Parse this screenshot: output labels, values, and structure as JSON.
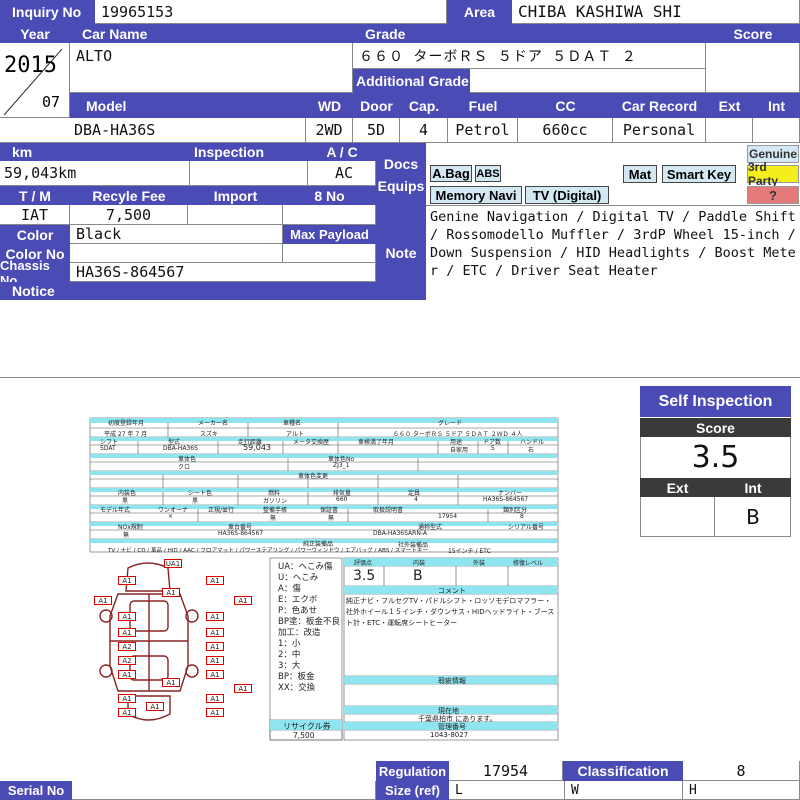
{
  "labels": {
    "inquiry_no": "Inquiry No",
    "area": "Area",
    "year": "Year",
    "car_name": "Car Name",
    "grade": "Grade",
    "score": "Score",
    "additional_grade": "Additional Grade",
    "model": "Model",
    "wd": "WD",
    "door": "Door",
    "cap": "Cap.",
    "fuel": "Fuel",
    "cc": "CC",
    "car_record": "Car Record",
    "ext": "Ext",
    "int": "Int",
    "km": "km",
    "inspection": "Inspection",
    "ac": "A / C",
    "docs_equips": [
      "Docs",
      "Equips"
    ],
    "tm": "T / M",
    "recycle_fee": "Recyle Fee",
    "import": "Import",
    "eight_no": "8 No",
    "color": "Color",
    "max_payload": "Max Payload",
    "color_no": "Color No",
    "note": "Note",
    "chassis_no": "Chassis No",
    "notice": "Notice",
    "regulation": "Regulation",
    "classification": "Classification",
    "serial_no": "Serial No",
    "size_ref": "Size (ref)"
  },
  "values": {
    "inquiry_no": "19965153",
    "area": "CHIBA KASHIWA SHI",
    "year": "2015",
    "month": "07",
    "car_name": "ALTO",
    "grade": "６６０ ターボＲＳ ５ドア ５ＤＡＴ ２",
    "model": "DBA-HA36S",
    "wd": "2WD",
    "door": "5D",
    "cap": "4",
    "fuel": "Petrol",
    "cc": "660cc",
    "car_record": "Personal",
    "km": "59,043km",
    "ac": "AC",
    "tm": "IAT",
    "recycle_fee": "7,500",
    "color": "Black",
    "chassis_no": "HA36S-864567",
    "note": "Genine Navigation / Digital TV / Paddle Shift / Rossomodello Muffler / 3rdP Wheel 15-inch / Down Suspension / HID Headlights / Boost Meter / ETC / Driver Seat Heater",
    "regulation": "17954",
    "classification": "8",
    "size_l": "L",
    "size_w": "W",
    "size_h": "H"
  },
  "equips": {
    "abag": "A.Bag",
    "abs": "ABS",
    "mat": "Mat",
    "smart_key": "Smart Key",
    "memory_navi": "Memory Navi",
    "tv_digital": "TV (Digital)",
    "genuine": "Genuine",
    "third_party": "3rd Party",
    "question": "?"
  },
  "self_inspection": {
    "title": "Self Inspection",
    "score_label": "Score",
    "score": "3.5",
    "ext_label": "Ext",
    "int_label": "Int",
    "ext": "",
    "int": "B"
  },
  "sheet": {
    "row1_labels": [
      "初度登録年月",
      "メーカー名",
      "車種名",
      "グレード"
    ],
    "row1_values": [
      "平成 27 年 7 月",
      "スズキ",
      "アルト",
      "６６０ ターボＲＳ ５ドア ５ＤＡＴ ２ＷＤ ４人"
    ],
    "row2_labels": [
      "シフト",
      "型式",
      "走行距離",
      "メータ交換歴",
      "車検満了年月",
      "用途",
      "ドア数",
      "ハンドル"
    ],
    "row2_values": [
      "5DAT",
      "DBA-HA36S",
      "59,043",
      "",
      "",
      "自家用",
      "5",
      "右"
    ],
    "color_label": "車体色",
    "color_value": "クロ",
    "color_code_label": "車体色No",
    "color_code_value": "ZJ3_1",
    "interior_label": "車体色変更",
    "row3_labels": [
      "内装色",
      "シート色",
      "燃料",
      "排気量",
      "定員",
      "ナンバー"
    ],
    "row3_values": [
      "黒",
      "黒",
      "ガソリン",
      "660",
      "4",
      "HA36S-864567"
    ],
    "row4_labels": [
      "モデル年式",
      "ワンオーナ",
      "正規/並行",
      "整備手帳",
      "保証書",
      "取扱説明書",
      "類別区分"
    ],
    "row4_values": [
      "",
      "×",
      "",
      "無",
      "無",
      "17954",
      "8"
    ],
    "nox_label": "NOx規制",
    "frame_label": "車台番号",
    "engine_label": "通称型式",
    "serial_label": "シリアル番号",
    "nox_value": "無",
    "frame_value": "HA36S-864567",
    "engine_value": "DBA-HA36SARN-A",
    "equip_label": "純正装備品",
    "equip_value": "TV / ナビ / CD / 革品 / HID / AAC / フロアマット / パワーステアリング / パワーウィンドウ / エアバッグ / ABS / スマートキー",
    "aftermarket_label": "社外装備品",
    "aftermarket_value": "15インチ / ETC",
    "legend": [
      "UA：へこみ傷",
      "U：へこみ",
      "A：傷",
      "E：エクボ",
      "P：色あせ",
      "BP塗：板金不良",
      "加工：改造",
      "1：小",
      "2：中",
      "3：大",
      "BP：板金",
      "XX：交換"
    ],
    "recycle_label": "リサイクル券",
    "recycle_value": "7,500",
    "grade_headers": [
      "評価点",
      "内装",
      "外装",
      "修復レベル"
    ],
    "grade_values": [
      "3.5",
      "B",
      "",
      ""
    ],
    "comment_label": "コメント",
    "comment": "純正ナビ・フルセグTV・パドルシフト・ロッソモデロマフラー・社外ホイール１５インチ・ダウンサス・HIDヘッドライト・ブースト計・ETC・運転席シートヒーター",
    "history_label": "瑕疵情報",
    "location_label": "現在地",
    "location_value": "千葉県柏市 にあります。",
    "manage_label": "管理番号",
    "manage_value": "1043-8027",
    "marks": [
      "UA1",
      "A1",
      "A1",
      "A1",
      "A1",
      "A1",
      "A1",
      "A1",
      "A1",
      "A1",
      "A2",
      "A1",
      "A2",
      "A1",
      "A1",
      "A1",
      "A1",
      "A1",
      "A1",
      "A1",
      "A1",
      "A1",
      "A1"
    ]
  },
  "colors": {
    "header_bg": "#4a4bb5",
    "badge_bg": "#d4e8f4",
    "third_party_bg": "#f6ee1c",
    "question_bg": "#e47a7a",
    "sheet_cyan": "#8ee4ef",
    "damage_red": "#dd0000"
  }
}
